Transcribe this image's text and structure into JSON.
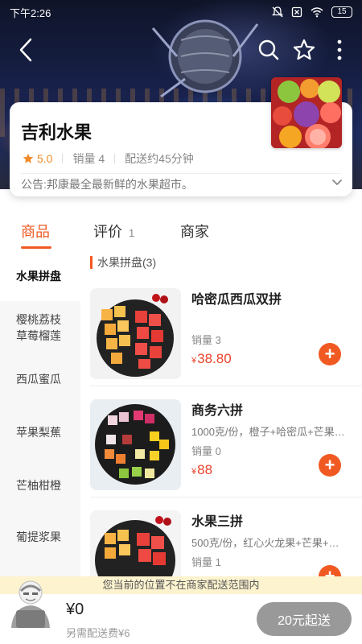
{
  "status_bar": {
    "time": "下午2:26",
    "battery": "15",
    "icons": [
      "mute-icon",
      "no-sim-icon",
      "wifi-icon",
      "battery-icon"
    ]
  },
  "header": {
    "back_icon": "back-arrow-icon",
    "search_icon": "search-icon",
    "favorite_icon": "star-outline-icon",
    "more_icon": "more-vertical-icon"
  },
  "store": {
    "name": "吉利水果",
    "rating": "5.0",
    "sales": "销量 4",
    "delivery": "配送约45分钟",
    "notice": "公告:邦康最全最新鲜的水果超市。"
  },
  "tabs": [
    {
      "label": "商品",
      "count": ""
    },
    {
      "label": "评价",
      "count": "1"
    },
    {
      "label": "商家",
      "count": ""
    }
  ],
  "categories": [
    "水果拼盘",
    "樱桃荔枝草莓榴莲",
    "西瓜蜜瓜",
    "苹果梨蕉",
    "芒柚柑橙",
    "葡提浆果"
  ],
  "section_title": "水果拼盘(3)",
  "products": [
    {
      "name": "哈密瓜西瓜双拼",
      "desc": "",
      "sales": "销量 3",
      "price": "38.80",
      "currency": "¥"
    },
    {
      "name": "商务六拼",
      "desc": "1000克/份，橙子+哈密瓜+芒果…",
      "sales": "销量 0",
      "price": "88",
      "currency": "¥"
    },
    {
      "name": "水果三拼",
      "desc": "500克/份，红心火龙果+芒果+…",
      "sales": "销量 1",
      "price": "",
      "currency": "¥"
    }
  ],
  "range_notice": "您当前的位置不在商家配送范围内",
  "cart": {
    "total": "¥0",
    "extra_fee": "另需配送费¥6",
    "checkout_label": "20元起送"
  },
  "colors": {
    "accent": "#f05a22",
    "price": "#e8432b",
    "rating_star": "#f08a24",
    "notice_bg": "#fdf3cf",
    "checkout_disabled": "#999999"
  }
}
